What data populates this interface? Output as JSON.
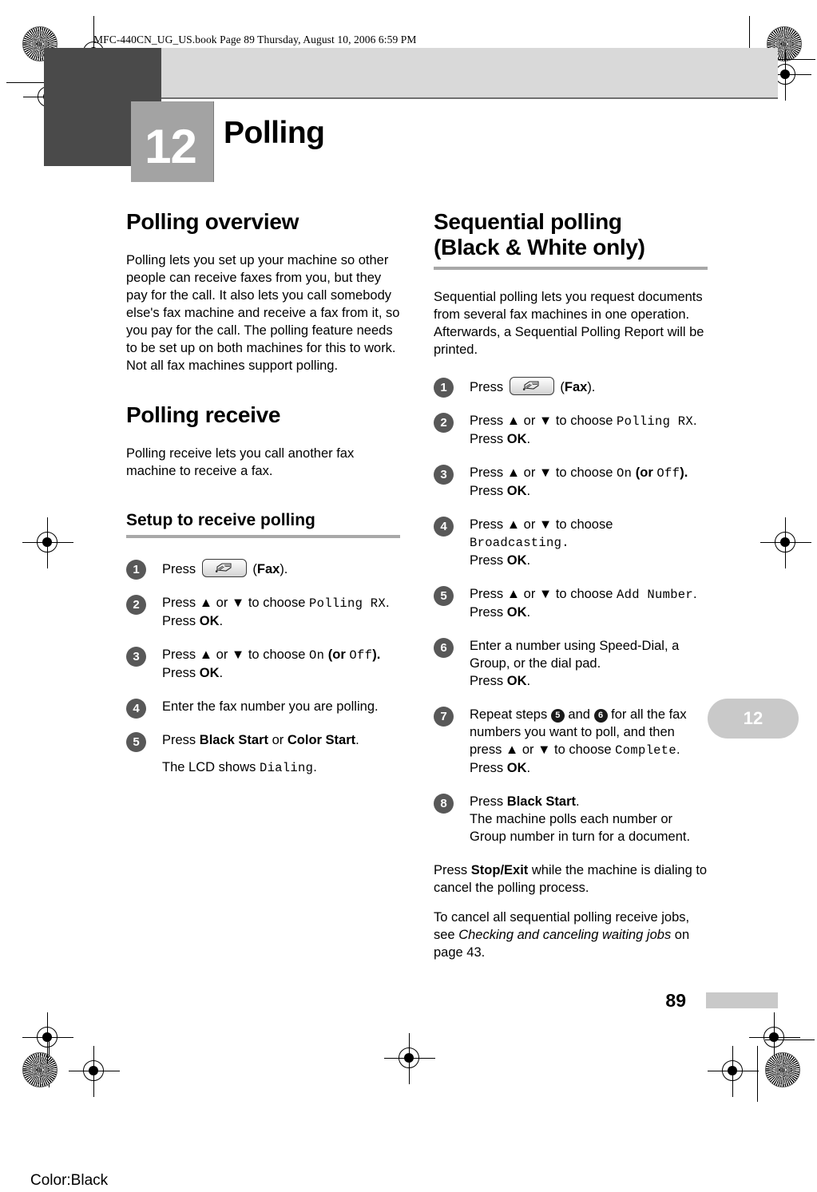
{
  "book_header": "MFC-440CN_UG_US.book  Page 89  Thursday, August 10, 2006  6:59 PM",
  "chapter": {
    "number": "12",
    "title": "Polling"
  },
  "side_tab": "12",
  "folio": "89",
  "color_mark": "Color:Black",
  "colors": {
    "corner_block": "#4a4a4a",
    "header_band": "#d9d9d9",
    "chapter_box": "#a3a3a3",
    "rule": "#a8a8a8",
    "badge": "#585858",
    "tab": "#c9c9c9"
  },
  "left_column": {
    "heading_overview": "Polling overview",
    "overview_text": "Polling lets you set up your machine so other people can receive faxes from you, but they pay for the call. It also lets you call somebody else's fax machine and receive a fax from it, so you pay for the call. The polling feature needs to be set up on both machines for this to work. Not all fax machines support polling.",
    "heading_receive": "Polling receive",
    "receive_text": "Polling receive lets you call another fax machine to receive a fax.",
    "subheading_setup": "Setup to receive polling",
    "steps": {
      "s1_press": "Press",
      "s1_fax": "Fax",
      "s2_a": "Press ▲ or ▼ to choose",
      "s2_lcd": "Polling RX",
      "s2_b": "Press",
      "s2_ok": "OK",
      "s3_a": "Press ▲ or ▼ to choose",
      "s3_on": "On",
      "s3_or": "(or",
      "s3_off": "Off",
      "s3_close": ").",
      "s3_b": "Press",
      "s3_ok": "OK",
      "s4": "Enter the fax number you are polling.",
      "s5_press": "Press",
      "s5_black": "Black Start",
      "s5_or": "or",
      "s5_color": "Color Start",
      "s5_lcd_pre": "The LCD shows",
      "s5_lcd": "Dialing"
    }
  },
  "right_column": {
    "heading_line1": "Sequential polling",
    "heading_line2": "(Black & White only)",
    "intro": "Sequential polling lets you request documents from several fax machines in one operation. Afterwards, a Sequential Polling Report will be printed.",
    "steps": {
      "s1_press": "Press",
      "s1_fax": "Fax",
      "s2_a": "Press ▲ or ▼ to choose",
      "s2_lcd": "Polling RX",
      "s2_b": "Press",
      "s2_ok": "OK",
      "s3_a": "Press ▲ or ▼ to choose",
      "s3_on": "On",
      "s3_or": "(or",
      "s3_off": "Off",
      "s3_close": ").",
      "s3_b": "Press",
      "s3_ok": "OK",
      "s4_a": "Press ▲ or ▼ to choose",
      "s4_lcd": "Broadcasting.",
      "s4_b": "Press",
      "s4_ok": "OK",
      "s5_a": "Press ▲ or ▼ to choose",
      "s5_lcd": "Add Number",
      "s5_b": "Press",
      "s5_ok": "OK",
      "s6_a": "Enter a number using Speed-Dial, a Group, or the dial pad.",
      "s6_b": "Press",
      "s6_ok": "OK",
      "s7_a": "Repeat steps",
      "s7_n1": "5",
      "s7_and": "and",
      "s7_n2": "6",
      "s7_b": "for all the fax numbers you want to poll, and then press ▲ or ▼ to choose",
      "s7_lcd": "Complete",
      "s7_c": "Press",
      "s7_ok": "OK",
      "s8_press": "Press",
      "s8_black": "Black Start",
      "s8_rest": "The machine polls each number or Group number in turn for a document."
    },
    "note_stop_pre": "Press",
    "note_stop_bold": "Stop/Exit",
    "note_stop_post": "while the machine is dialing to cancel the polling process.",
    "xref_pre": "To cancel all sequential polling receive jobs, see",
    "xref_italic": "Checking and canceling waiting jobs",
    "xref_post": "on page 43."
  }
}
